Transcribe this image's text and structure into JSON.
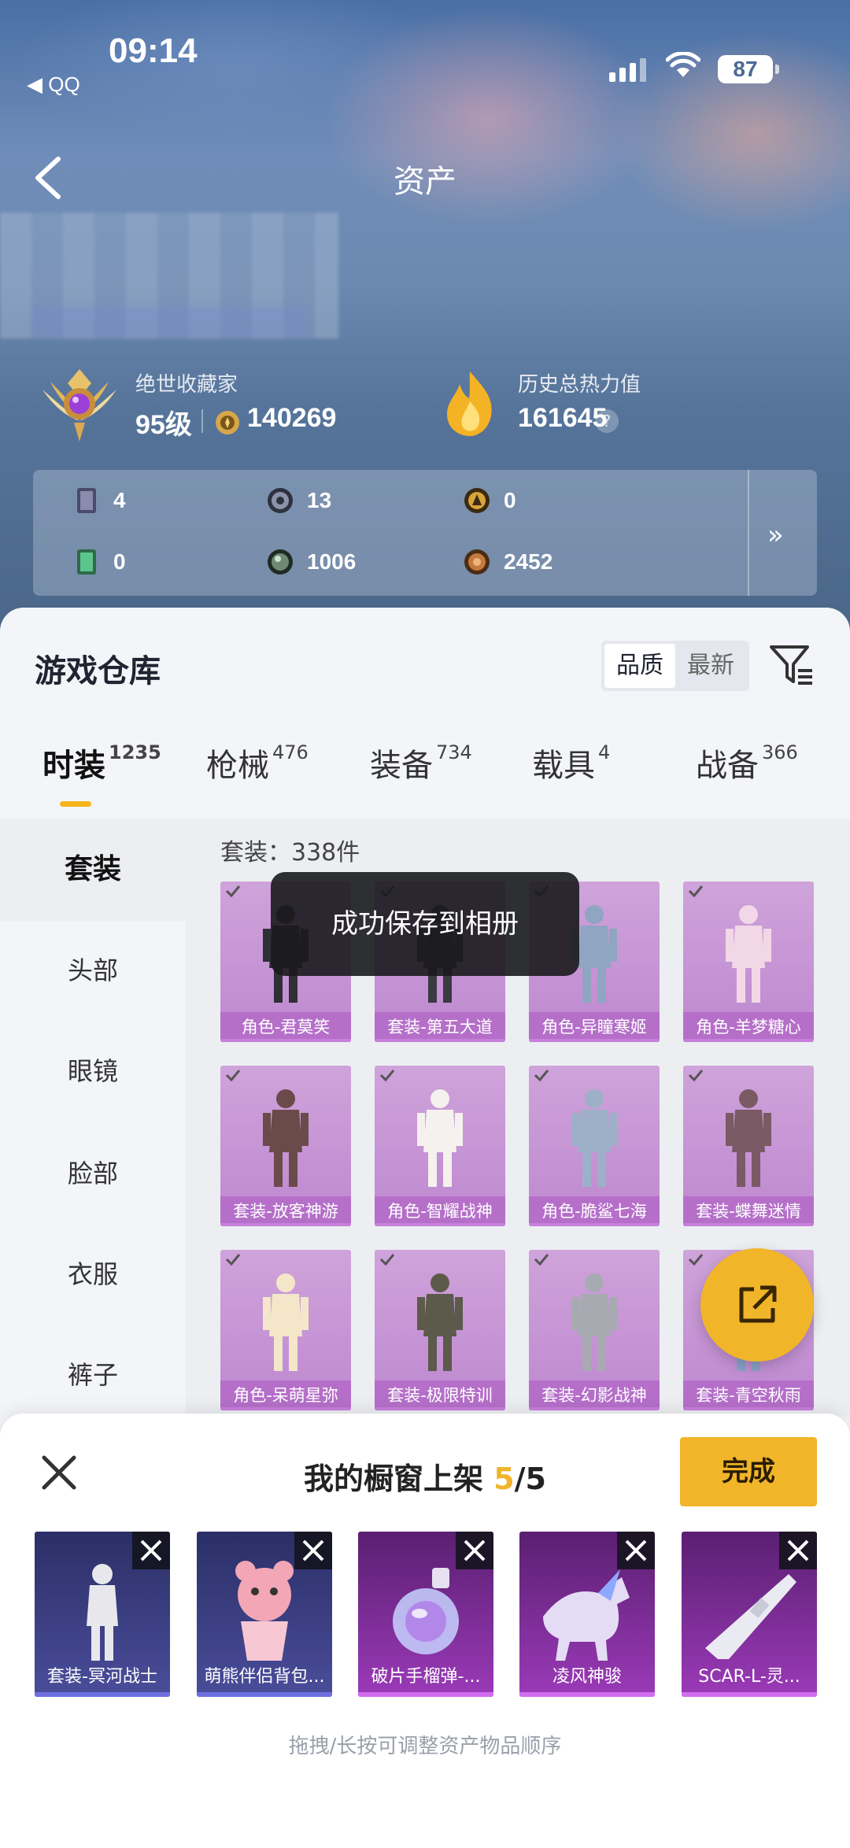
{
  "status_bar": {
    "time": "09:14",
    "back_app": "◀ QQ",
    "battery": "87"
  },
  "nav": {
    "title": "资产"
  },
  "profile": {
    "rank_title": "绝世收藏家",
    "rank_level": "95级",
    "rank_points": "140269",
    "heat_title": "历史总热力值",
    "heat_value": "161645",
    "help": "?"
  },
  "resources": {
    "items": [
      {
        "icon": "card-icon",
        "value": "4"
      },
      {
        "icon": "silver-token-icon",
        "value": "13"
      },
      {
        "icon": "gold-token-icon",
        "value": "0"
      },
      {
        "icon": "green-card-icon",
        "value": "0"
      },
      {
        "icon": "orb-icon",
        "value": "1006"
      },
      {
        "icon": "bronze-coin-icon",
        "value": "2452"
      }
    ],
    "more": "»"
  },
  "warehouse": {
    "title": "游戏仓库",
    "sort_options": [
      "品质",
      "最新"
    ],
    "active_sort": "品质"
  },
  "categories": [
    {
      "label": "时装",
      "count": "1235"
    },
    {
      "label": "枪械",
      "count": "476"
    },
    {
      "label": "装备",
      "count": "734"
    },
    {
      "label": "载具",
      "count": "4"
    },
    {
      "label": "战备",
      "count": "366"
    }
  ],
  "side_nav": [
    "套装",
    "头部",
    "眼镜",
    "脸部",
    "衣服",
    "裤子"
  ],
  "set_count": "套装：338件",
  "items": [
    "角色-君莫笑",
    "套装-第五大道",
    "角色-异瞳寒姬",
    "角色-羊梦糖心",
    "套装-放客神游",
    "角色-智耀战神",
    "角色-脆鲨七海",
    "套装-蝶舞迷情",
    "角色-呆萌星弥",
    "套装-极限特训",
    "套装-幻影战神",
    "套装-青空秋雨"
  ],
  "toast": "成功保存到相册",
  "showcase": {
    "title_prefix": "我的橱窗上架 ",
    "current": "5",
    "total": "/5",
    "done_label": "完成",
    "slots": [
      "套装-冥河战士",
      "萌熊伴侣背包...",
      "破片手榴弹-...",
      "凌风神骏",
      "SCAR-L-灵..."
    ],
    "hint": "拖拽/长按可调整资产物品顺序"
  },
  "colors": {
    "accent": "#f1b52a",
    "card_purple": "#c88fd6",
    "slot_blue": "#3a3d86",
    "slot_purple": "#8a33a8"
  }
}
